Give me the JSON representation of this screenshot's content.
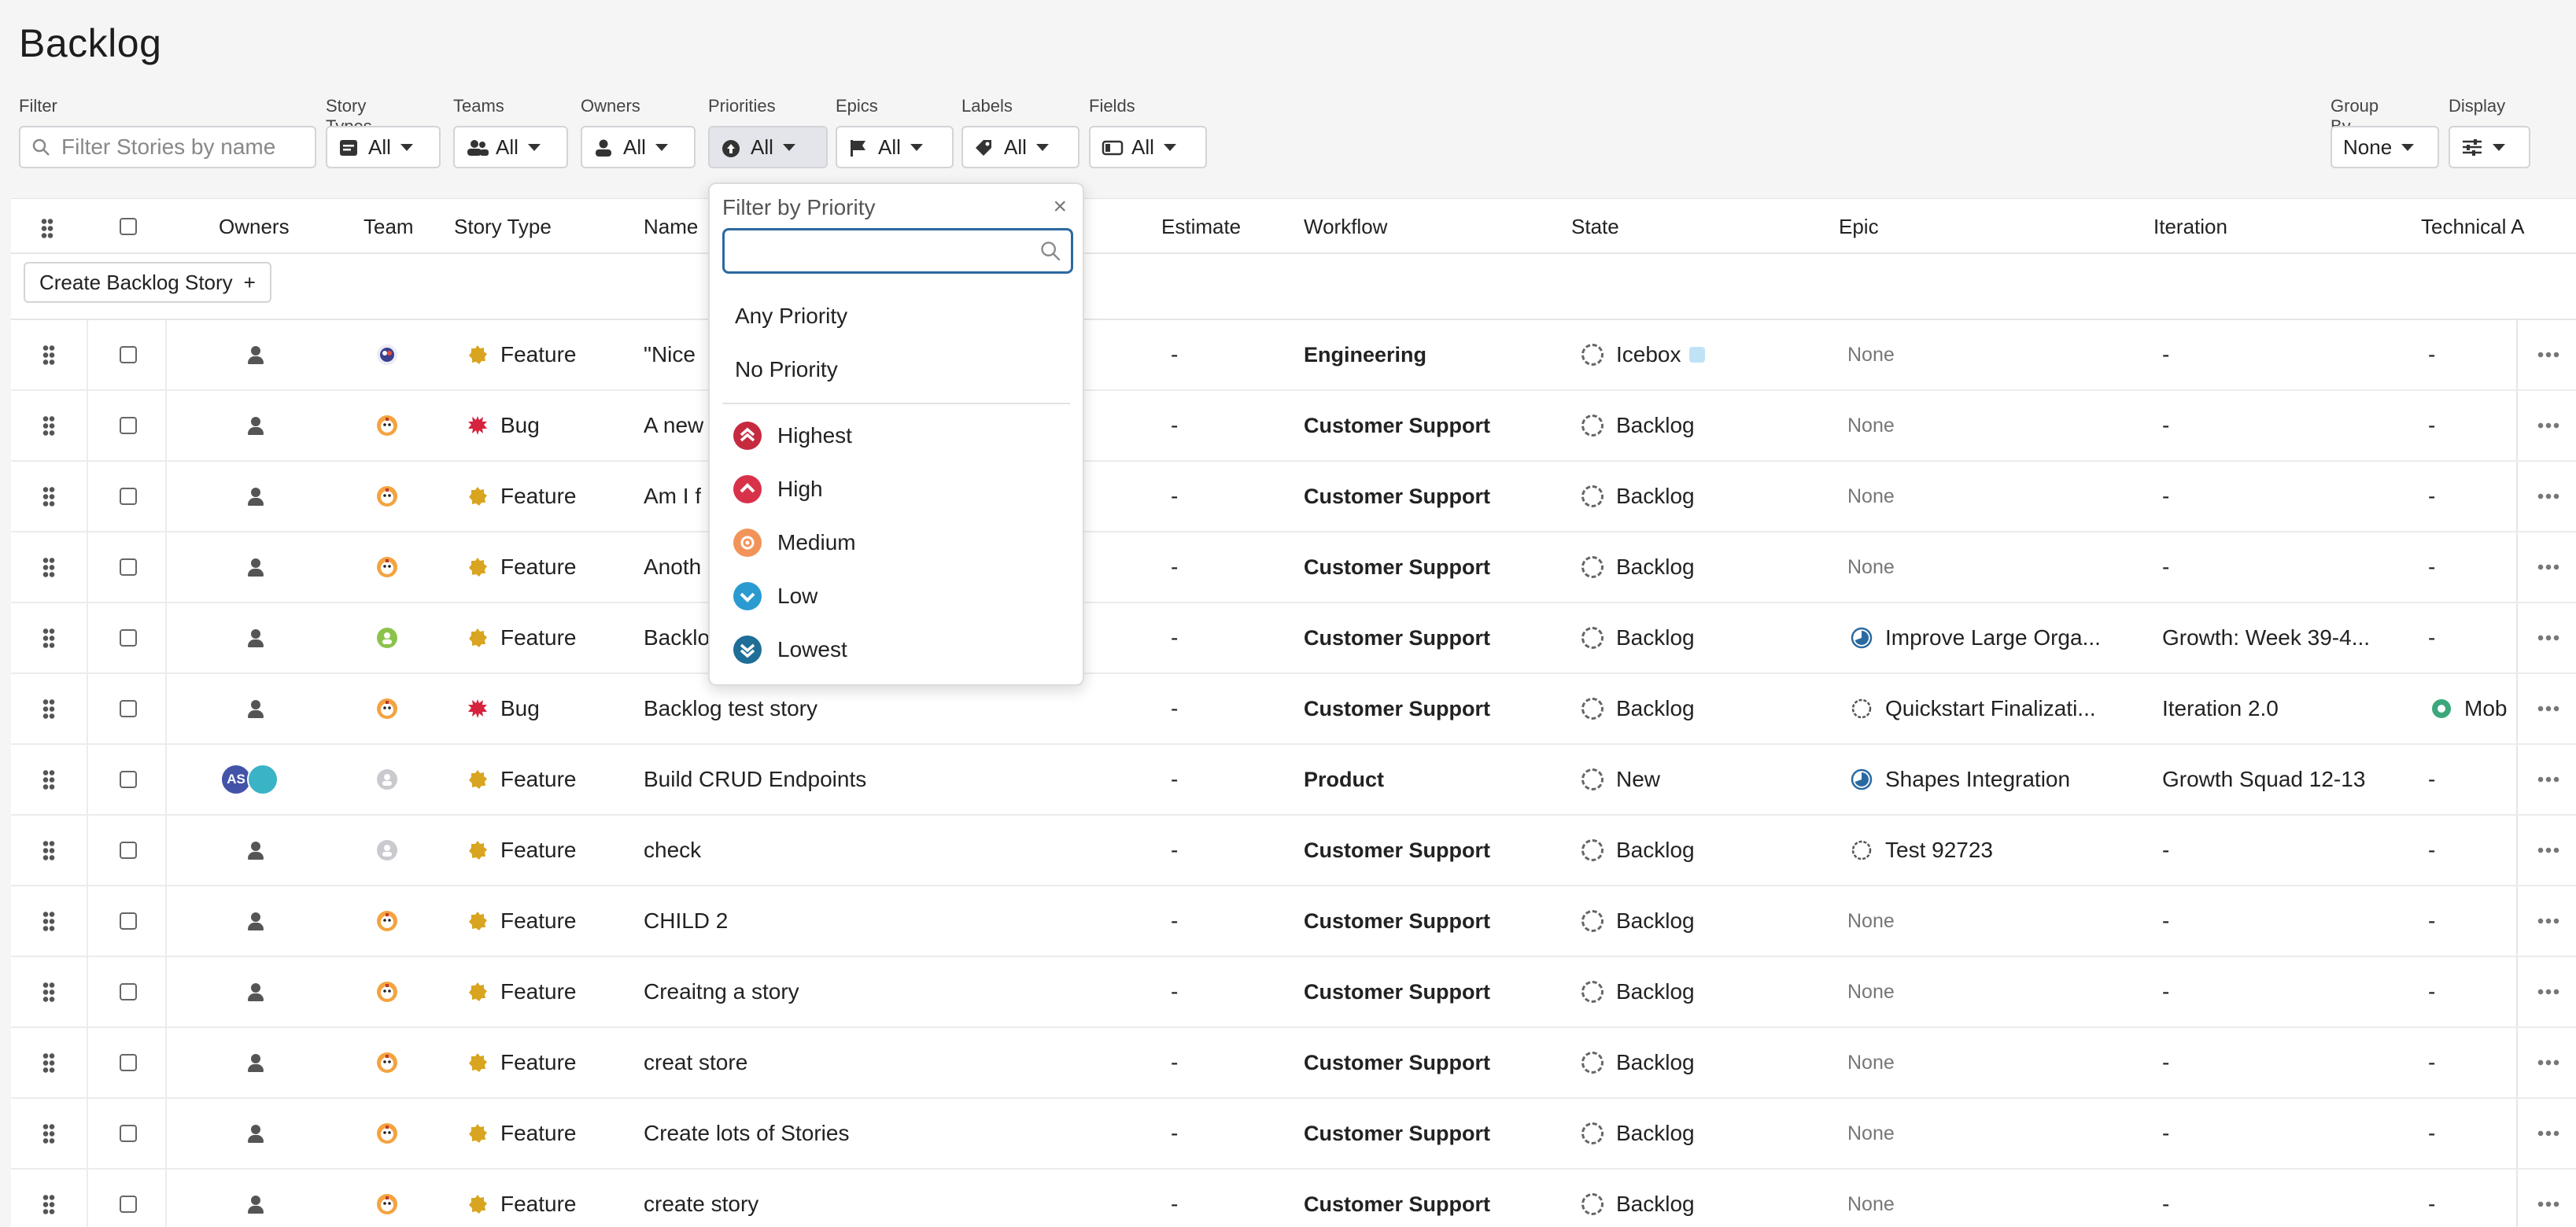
{
  "page": {
    "title": "Backlog"
  },
  "filters": {
    "filter_label": "Filter",
    "search_placeholder": "Filter Stories by name",
    "groups": [
      {
        "label": "Story Types",
        "value": "All",
        "icon": "story-card-icon"
      },
      {
        "label": "Teams",
        "value": "All",
        "icon": "team-icon"
      },
      {
        "label": "Owners",
        "value": "All",
        "icon": "person-icon"
      },
      {
        "label": "Priorities",
        "value": "All",
        "icon": "priority-arrow-icon"
      },
      {
        "label": "Epics",
        "value": "All",
        "icon": "flag-icon"
      },
      {
        "label": "Labels",
        "value": "All",
        "icon": "tag-icon"
      },
      {
        "label": "Fields",
        "value": "All",
        "icon": "field-icon"
      }
    ],
    "group_by": {
      "label": "Group By",
      "value": "None"
    },
    "display": {
      "label": "Display",
      "icon": "sliders-icon"
    }
  },
  "table": {
    "columns": [
      "Owners",
      "Team",
      "Story Type",
      "Name",
      "Estimate",
      "Workflow",
      "State",
      "Epic",
      "Iteration",
      "Technical A"
    ],
    "create_label": "Create Backlog Story",
    "create_icon": "+",
    "rows": [
      {
        "owners": "",
        "team": "owl",
        "type": "Feature",
        "name": "\"Nice",
        "estimate": "-",
        "workflow": "Engineering",
        "state": "Icebox",
        "state_badge": true,
        "epic": "None",
        "epic_icon": "",
        "iteration": "-",
        "tech": "-"
      },
      {
        "owners": "",
        "team": "tiger",
        "type": "Bug",
        "name": "A new",
        "estimate": "-",
        "workflow": "Customer Support",
        "state": "Backlog",
        "epic": "None",
        "epic_icon": "",
        "iteration": "-",
        "tech": "-"
      },
      {
        "owners": "",
        "team": "tiger",
        "type": "Feature",
        "name": "Am I f",
        "estimate": "-",
        "workflow": "Customer Support",
        "state": "Backlog",
        "epic": "None",
        "epic_icon": "",
        "iteration": "-",
        "tech": "-"
      },
      {
        "owners": "",
        "team": "tiger",
        "type": "Feature",
        "name": "Anoth",
        "estimate": "-",
        "workflow": "Customer Support",
        "state": "Backlog",
        "epic": "None",
        "epic_icon": "",
        "iteration": "-",
        "tech": "-"
      },
      {
        "owners": "",
        "team": "green",
        "type": "Feature",
        "name": "Backlo",
        "estimate": "-",
        "workflow": "Customer Support",
        "state": "Backlog",
        "epic": "Improve Large Orga...",
        "epic_icon": "progress",
        "iteration": "Growth: Week 39-4...",
        "tech": "-"
      },
      {
        "owners": "",
        "team": "tiger",
        "type": "Bug",
        "name": "Backlog test story",
        "estimate": "-",
        "workflow": "Customer Support",
        "state": "Backlog",
        "epic": "Quickstart Finalizati...",
        "epic_icon": "todo",
        "iteration": "Iteration 2.0",
        "tech": "Mob"
      },
      {
        "owners": "AS",
        "team": "grey",
        "type": "Feature",
        "name": "Build CRUD Endpoints",
        "estimate": "-",
        "workflow": "Product",
        "state": "New",
        "epic": "Shapes Integration",
        "epic_icon": "progress",
        "iteration": "Growth Squad 12-13",
        "tech": "-"
      },
      {
        "owners": "",
        "team": "grey",
        "type": "Feature",
        "name": "check",
        "estimate": "-",
        "workflow": "Customer Support",
        "state": "Backlog",
        "epic": "Test 92723",
        "epic_icon": "todo",
        "iteration": "-",
        "tech": "-"
      },
      {
        "owners": "",
        "team": "tiger",
        "type": "Feature",
        "name": "CHILD 2",
        "estimate": "-",
        "workflow": "Customer Support",
        "state": "Backlog",
        "epic": "None",
        "epic_icon": "",
        "iteration": "-",
        "tech": "-"
      },
      {
        "owners": "",
        "team": "tiger",
        "type": "Feature",
        "name": "Creaitng a story",
        "estimate": "-",
        "workflow": "Customer Support",
        "state": "Backlog",
        "epic": "None",
        "epic_icon": "",
        "iteration": "-",
        "tech": "-"
      },
      {
        "owners": "",
        "team": "tiger",
        "type": "Feature",
        "name": "creat store",
        "estimate": "-",
        "workflow": "Customer Support",
        "state": "Backlog",
        "epic": "None",
        "epic_icon": "",
        "iteration": "-",
        "tech": "-"
      },
      {
        "owners": "",
        "team": "tiger",
        "type": "Feature",
        "name": "Create lots of Stories",
        "estimate": "-",
        "workflow": "Customer Support",
        "state": "Backlog",
        "epic": "None",
        "epic_icon": "",
        "iteration": "-",
        "tech": "-"
      },
      {
        "owners": "",
        "team": "tiger",
        "type": "Feature",
        "name": "create story",
        "estimate": "-",
        "workflow": "Customer Support",
        "state": "Backlog",
        "epic": "None",
        "epic_icon": "",
        "iteration": "-",
        "tech": "-"
      }
    ]
  },
  "priority_dropdown": {
    "title": "Filter by Priority",
    "close": "×",
    "search_value": "",
    "options_plain": [
      "Any Priority",
      "No Priority"
    ],
    "options": [
      {
        "label": "Highest",
        "color": "#c62a3f",
        "icon": "double-chevron-up-icon"
      },
      {
        "label": "High",
        "color": "#d8324a",
        "icon": "chevron-up-icon"
      },
      {
        "label": "Medium",
        "color": "#f2945a",
        "icon": "circle-dot-icon"
      },
      {
        "label": "Low",
        "color": "#2b9ad1",
        "icon": "chevron-down-icon"
      },
      {
        "label": "Lowest",
        "color": "#1e6e97",
        "icon": "double-chevron-down-icon"
      }
    ]
  },
  "colors": {
    "feature": "#d9a520",
    "bug": "#d6233e",
    "accent": "#2b6aa0"
  }
}
